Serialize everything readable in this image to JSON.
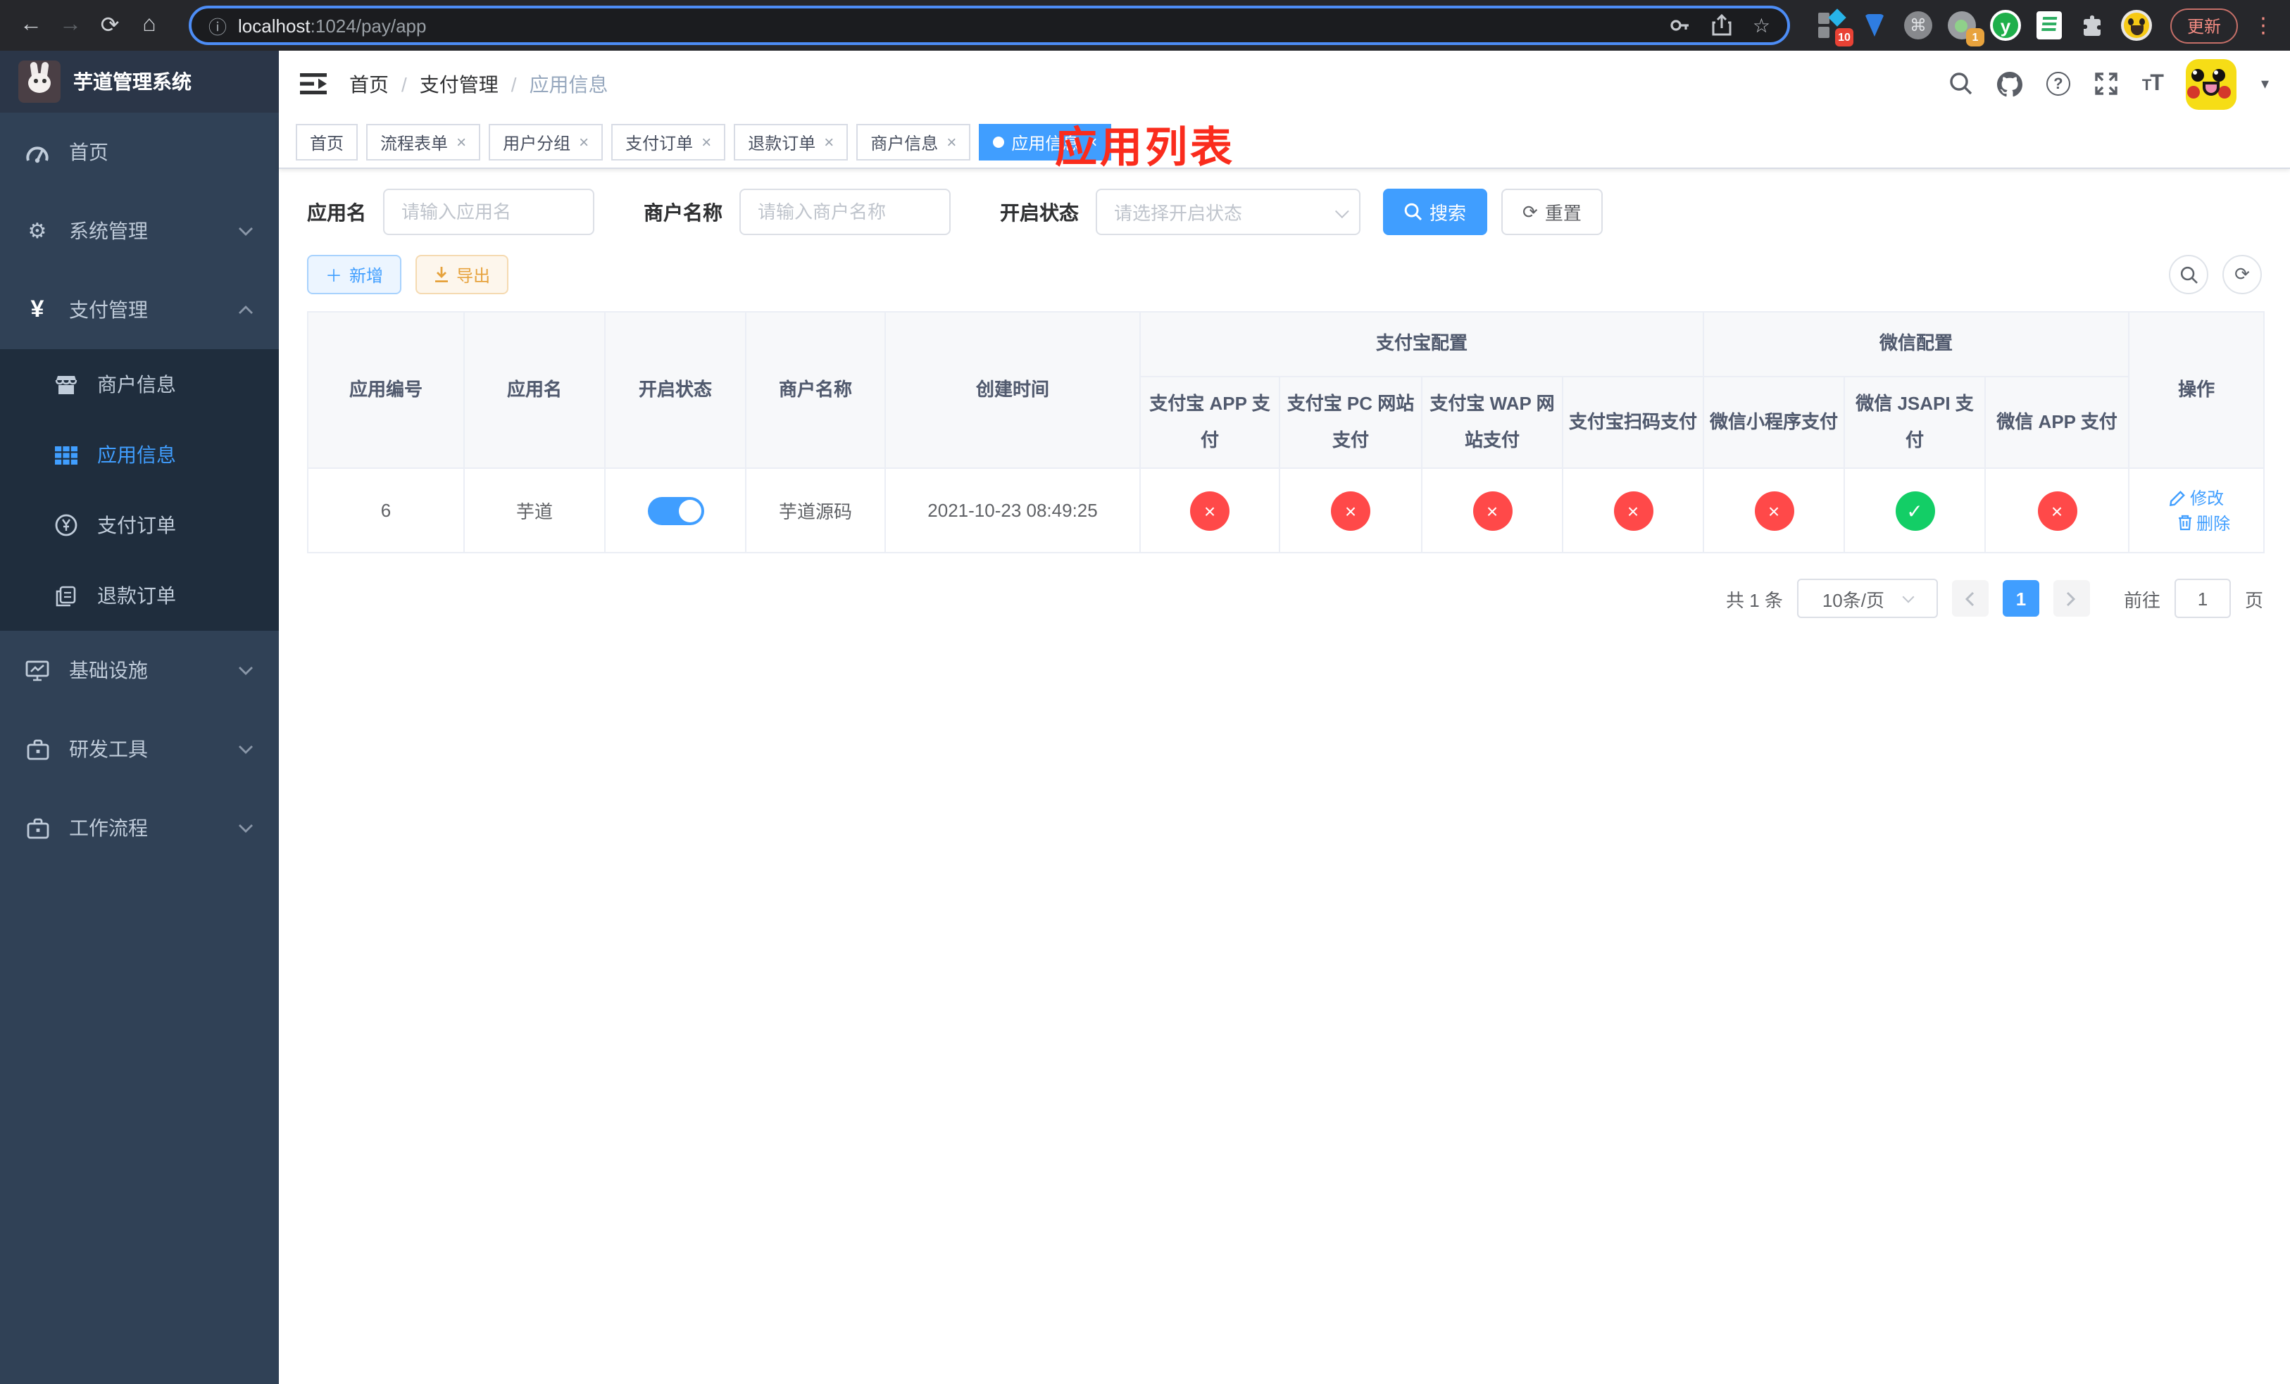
{
  "browser": {
    "url_host": "localhost",
    "url_path": ":1024/pay/app",
    "update_label": "更新",
    "ext_badge_blue": "10",
    "ext_badge_tag": "1"
  },
  "icons": {
    "back": "←",
    "forward": "→",
    "reload": "⟳",
    "home": "⌂",
    "info": "ⓘ",
    "star": "☆",
    "command": "⌘",
    "menu_dots": "⋮",
    "close": "×",
    "caret_down": "▾",
    "gear": "⚙",
    "yen": "¥",
    "refresh": "⟳",
    "plus": "＋",
    "y_letter": "y"
  },
  "sidebar": {
    "title": "芋道管理系统",
    "items": [
      {
        "label": "首页"
      },
      {
        "label": "系统管理"
      },
      {
        "label": "支付管理"
      },
      {
        "label": "基础设施"
      },
      {
        "label": "研发工具"
      },
      {
        "label": "工作流程"
      }
    ],
    "submenu": [
      {
        "label": "商户信息"
      },
      {
        "label": "应用信息"
      },
      {
        "label": "支付订单"
      },
      {
        "label": "退款订单"
      }
    ]
  },
  "header": {
    "breadcrumb": [
      "首页",
      "支付管理",
      "应用信息"
    ],
    "annotation": "应用列表"
  },
  "tabs": [
    {
      "label": "首页"
    },
    {
      "label": "流程表单"
    },
    {
      "label": "用户分组"
    },
    {
      "label": "支付订单"
    },
    {
      "label": "退款订单"
    },
    {
      "label": "商户信息"
    },
    {
      "label": "应用信息"
    }
  ],
  "filters": {
    "app_name_label": "应用名",
    "app_name_placeholder": "请输入应用名",
    "merchant_label": "商户名称",
    "merchant_placeholder": "请输入商户名称",
    "status_label": "开启状态",
    "status_placeholder": "请选择开启状态",
    "search_label": "搜索",
    "reset_label": "重置"
  },
  "toolbar": {
    "add_label": "新增",
    "export_label": "导出"
  },
  "table": {
    "columns": [
      "应用编号",
      "应用名",
      "开启状态",
      "商户名称",
      "创建时间"
    ],
    "group_alipay": "支付宝配置",
    "group_wechat": "微信配置",
    "sub_columns": [
      "支付宝 APP 支付",
      "支付宝 PC 网站支付",
      "支付宝 WAP 网站支付",
      "支付宝扫码支付",
      "微信小程序支付",
      "微信 JSAPI 支付",
      "微信 APP 支付"
    ],
    "actions_label": "操作",
    "row": {
      "id": "6",
      "name": "芋道",
      "merchant": "芋道源码",
      "created": "2021-10-23 08:49:25",
      "statuses": [
        {
          "glyph": "×",
          "color": "#ff4949"
        },
        {
          "glyph": "×",
          "color": "#ff4949"
        },
        {
          "glyph": "×",
          "color": "#ff4949"
        },
        {
          "glyph": "×",
          "color": "#ff4949"
        },
        {
          "glyph": "×",
          "color": "#ff4949"
        },
        {
          "glyph": "✓",
          "color": "#13ce66"
        },
        {
          "glyph": "×",
          "color": "#ff4949"
        }
      ],
      "edit_label": "修改",
      "delete_label": "删除"
    }
  },
  "pagination": {
    "total": "共 1 条",
    "per_page": "10条/页",
    "current_page": "1",
    "goto_label": "前往",
    "goto_value": "1",
    "page_unit": "页"
  },
  "colors": {
    "accent": "#409eff",
    "danger": "#ff4949",
    "success": "#13ce66"
  }
}
